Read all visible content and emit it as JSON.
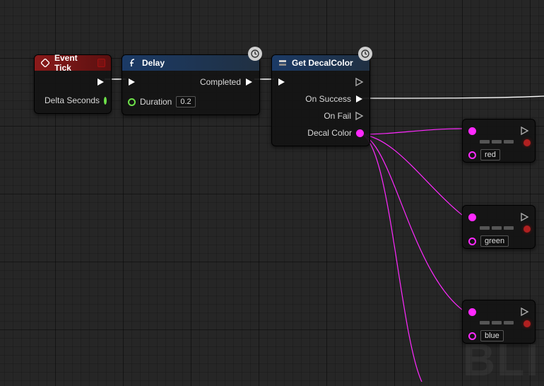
{
  "event_tick": {
    "title": "Event Tick",
    "pins": {
      "delta_seconds": "Delta Seconds"
    }
  },
  "delay": {
    "title": "Delay",
    "pins": {
      "completed": "Completed",
      "duration": "Duration"
    },
    "duration_value": "0.2"
  },
  "get_decal": {
    "title": "Get DecalColor",
    "pins": {
      "on_success": "On Success",
      "on_fail": "On Fail",
      "decal_color": "Decal Color"
    }
  },
  "break_nodes": {
    "r": {
      "label": "red"
    },
    "g": {
      "label": "green"
    },
    "b": {
      "label": "blue"
    }
  },
  "watermark": "BLI"
}
